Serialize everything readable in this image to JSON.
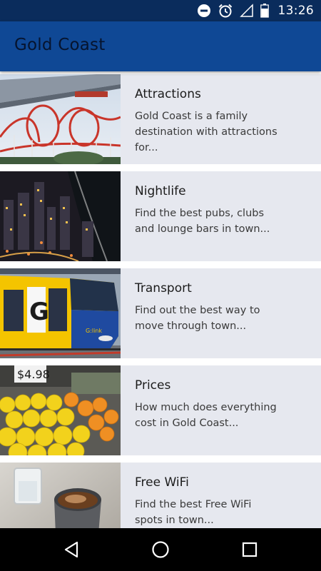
{
  "status_bar": {
    "time": "13:26",
    "icons": [
      "do-not-disturb-icon",
      "alarm-icon",
      "signal-icon",
      "battery-icon"
    ]
  },
  "app_bar": {
    "title": "Gold Coast",
    "color": "#0f4895"
  },
  "categories": [
    {
      "title": "Attractions",
      "description": "Gold Coast is a family destination with attractions for...",
      "image": "roller-coaster-image"
    },
    {
      "title": "Nightlife",
      "description": "Find the best pubs, clubs and lounge bars in town...",
      "image": "city-night-image"
    },
    {
      "title": "Transport",
      "description": "Find out the best way to move through town...",
      "image": "tram-image"
    },
    {
      "title": "Prices",
      "description": "How much does everything cost in Gold Coast...",
      "image": "fruit-market-image"
    },
    {
      "title": "Free WiFi",
      "description": "Find the best Free WiFi spots in town...",
      "image": "coffee-cup-image"
    }
  ],
  "nav_bar": {
    "buttons": [
      "back-icon",
      "home-icon",
      "recents-icon"
    ]
  }
}
